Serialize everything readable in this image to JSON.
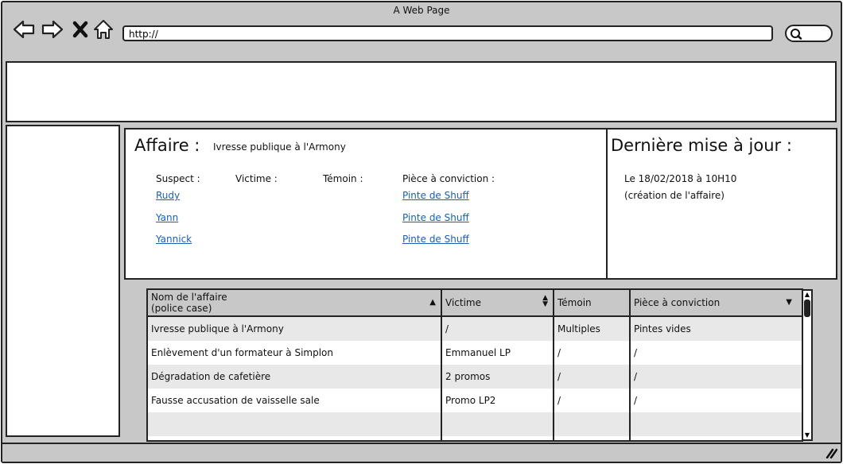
{
  "browser": {
    "title": "A Web Page",
    "url": "http://"
  },
  "affaire": {
    "label": "Affaire :",
    "name": "Ivresse publique à l'Armony",
    "columns": {
      "suspect": "Suspect :",
      "victime": "Victime :",
      "temoin": "Témoin :",
      "piece": "Pièce à conviction :"
    },
    "suspects": [
      "Rudy",
      "Yann",
      "Yannick"
    ],
    "pieces": [
      "Pinte de Shuff",
      "Pinte de Shuff",
      "Pinte de Shuff"
    ]
  },
  "update": {
    "title": "Dernière mise à jour :",
    "line1": "Le 18/02/2018 à 10H10",
    "line2": "(création de l'affaire)"
  },
  "table": {
    "headers": {
      "col1_line1": "Nom de l'affaire",
      "col1_line2": "(police case)",
      "col2": "Victime",
      "col3": "Témoin",
      "col4": "Pièce à conviction"
    },
    "rows": [
      [
        "Ivresse publique à l'Armony",
        "/",
        "Multiples",
        "Pintes vides"
      ],
      [
        "Enlèvement d'un formateur à Simplon",
        "Emmanuel LP",
        "/",
        "/"
      ],
      [
        "Dégradation de cafetière",
        "2 promos",
        "/",
        "/"
      ],
      [
        "Fausse accusation de vaisselle sale",
        "Promo LP2",
        "/",
        "/"
      ],
      [
        "",
        "",
        "",
        ""
      ]
    ]
  }
}
